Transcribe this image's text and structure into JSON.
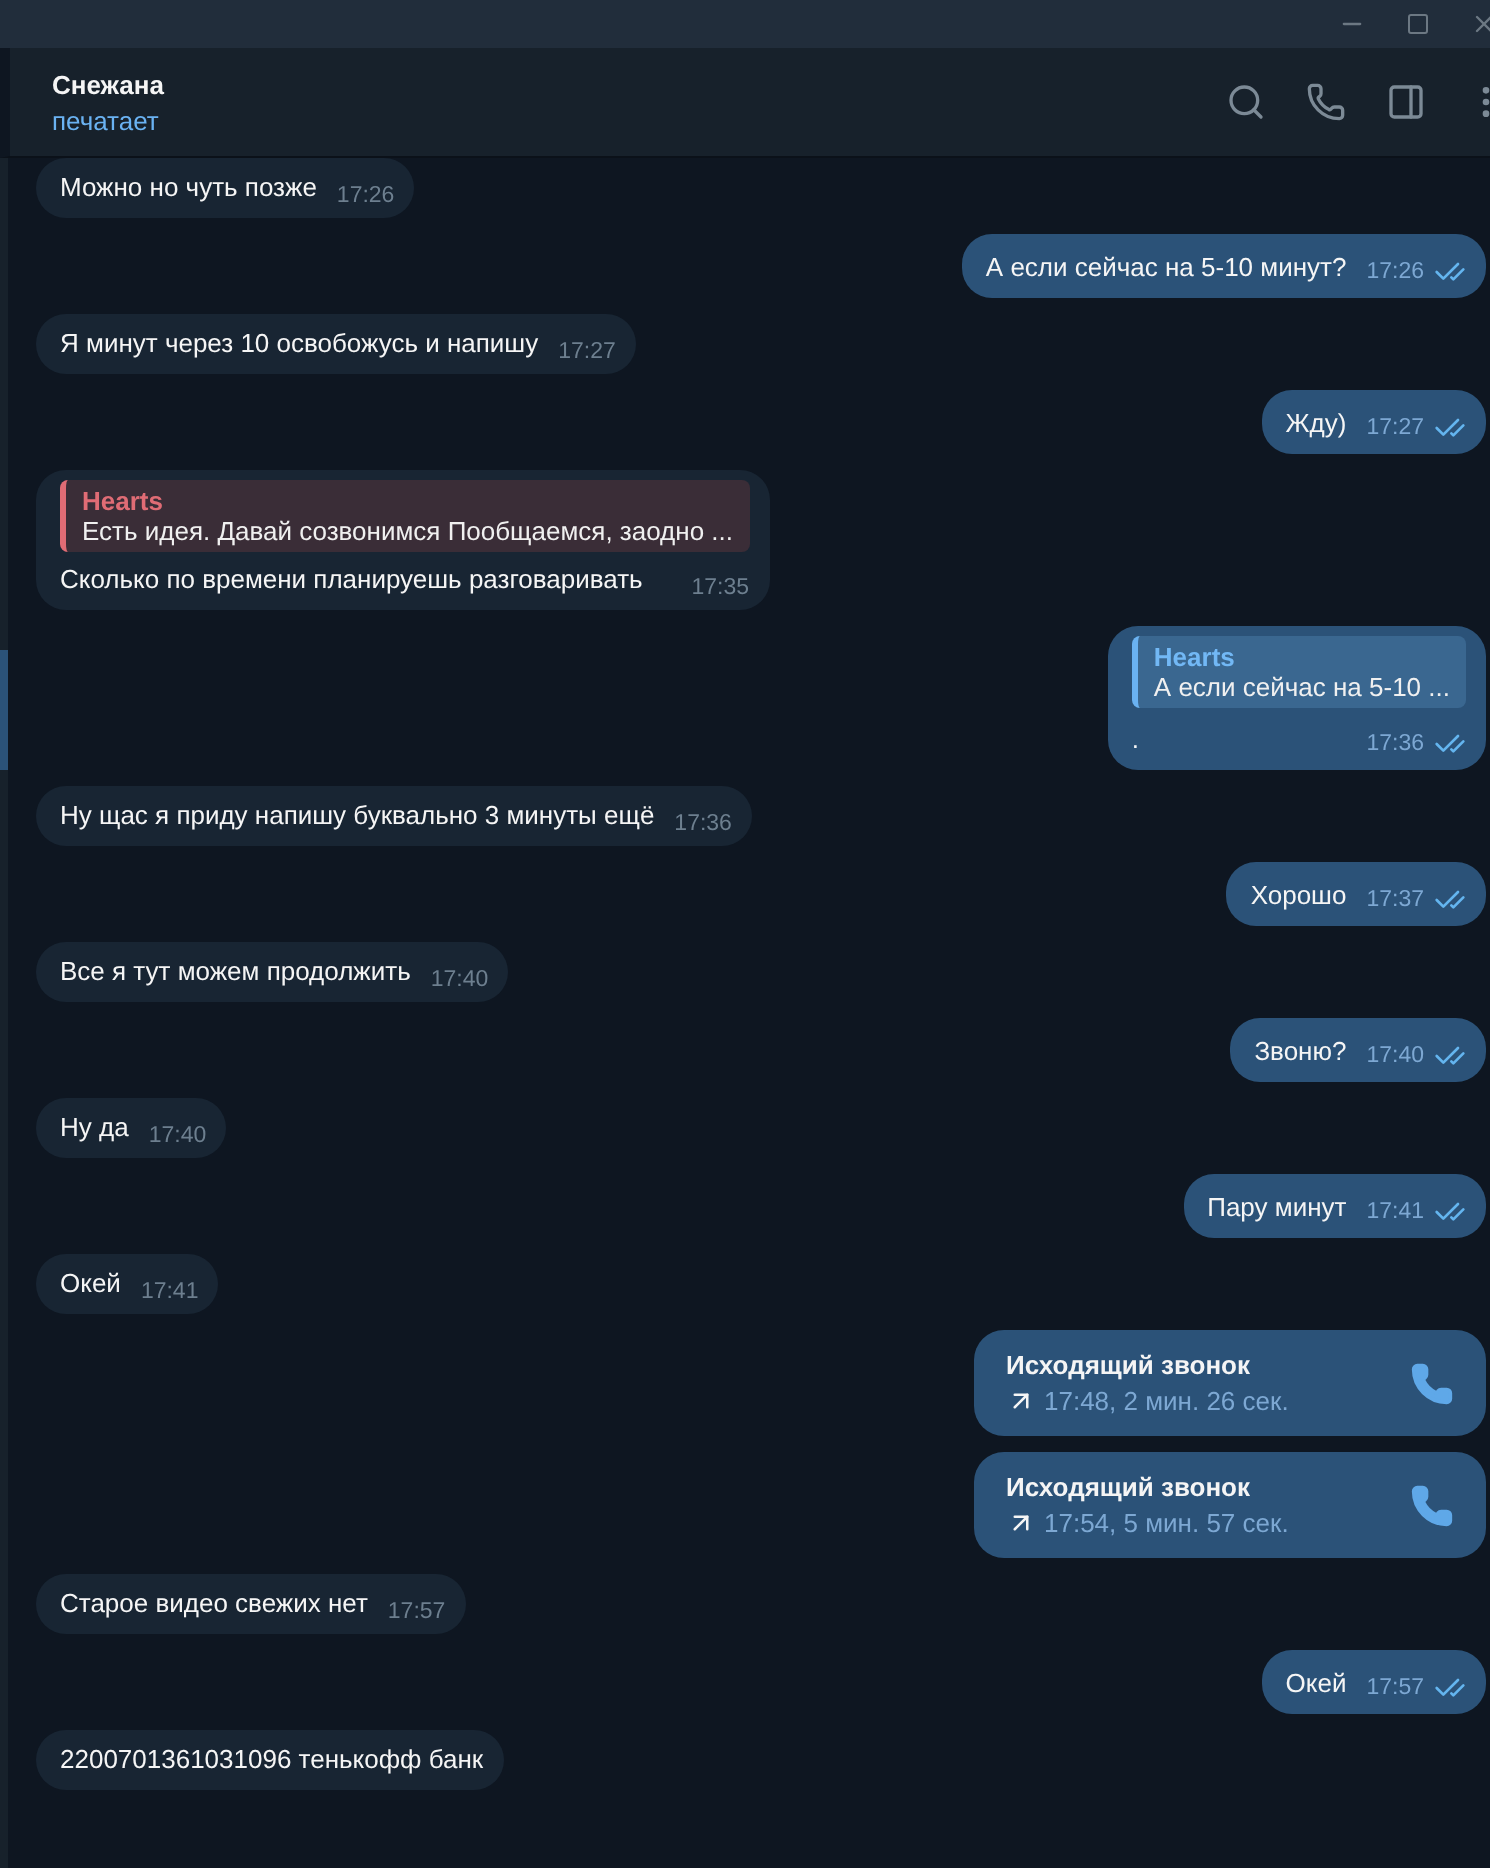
{
  "chat": {
    "name": "Снежана",
    "status": "печатает"
  },
  "messages": [
    {
      "kind": "text",
      "outgoing": false,
      "text": "Можно но чуть позже",
      "time": "17:26"
    },
    {
      "kind": "text",
      "outgoing": true,
      "read": true,
      "text": "А если сейчас на 5-10 минут?",
      "time": "17:26"
    },
    {
      "kind": "text",
      "outgoing": false,
      "text": "Я минут через 10 освобожусь и напишу",
      "time": "17:27"
    },
    {
      "kind": "text",
      "outgoing": true,
      "read": true,
      "text": "Жду)",
      "time": "17:27"
    },
    {
      "kind": "reply",
      "outgoing": false,
      "reply_author": "Hearts",
      "reply_text": "Есть идея. Давай созвонимся   Пообщаемся, заодно ...",
      "text": "Сколько по времени планируешь разговаривать",
      "time": "17:35"
    },
    {
      "kind": "reply",
      "outgoing": true,
      "read": true,
      "reply_author": "Hearts",
      "reply_text": "А если сейчас на 5-10 ...",
      "text": ".",
      "time": "17:36"
    },
    {
      "kind": "text",
      "outgoing": false,
      "text": "Ну щас я приду напишу буквально 3 минуты ещё",
      "time": "17:36"
    },
    {
      "kind": "text",
      "outgoing": true,
      "read": true,
      "text": "Хорошо",
      "time": "17:37"
    },
    {
      "kind": "text",
      "outgoing": false,
      "text": "Все я тут можем продолжить",
      "time": "17:40"
    },
    {
      "kind": "text",
      "outgoing": true,
      "read": true,
      "text": "Звоню?",
      "time": "17:40"
    },
    {
      "kind": "text",
      "outgoing": false,
      "text": "Ну да",
      "time": "17:40"
    },
    {
      "kind": "text",
      "outgoing": true,
      "read": true,
      "text": "Пару минут",
      "time": "17:41"
    },
    {
      "kind": "text",
      "outgoing": false,
      "text": "Окей",
      "time": "17:41"
    },
    {
      "kind": "call",
      "outgoing": true,
      "text": "Исходящий звонок",
      "time": "17:48, 2 мин. 26 сек."
    },
    {
      "kind": "call",
      "outgoing": true,
      "text": "Исходящий звонок",
      "time": "17:54, 5 мин. 57 сек."
    },
    {
      "kind": "text",
      "outgoing": false,
      "text": "Старое видео свежих нет",
      "time": "17:57"
    },
    {
      "kind": "text",
      "outgoing": true,
      "read": true,
      "text": "Окей",
      "time": "17:57"
    },
    {
      "kind": "text",
      "outgoing": false,
      "text": "2200701361031096 тенькофф банк"
    }
  ]
}
